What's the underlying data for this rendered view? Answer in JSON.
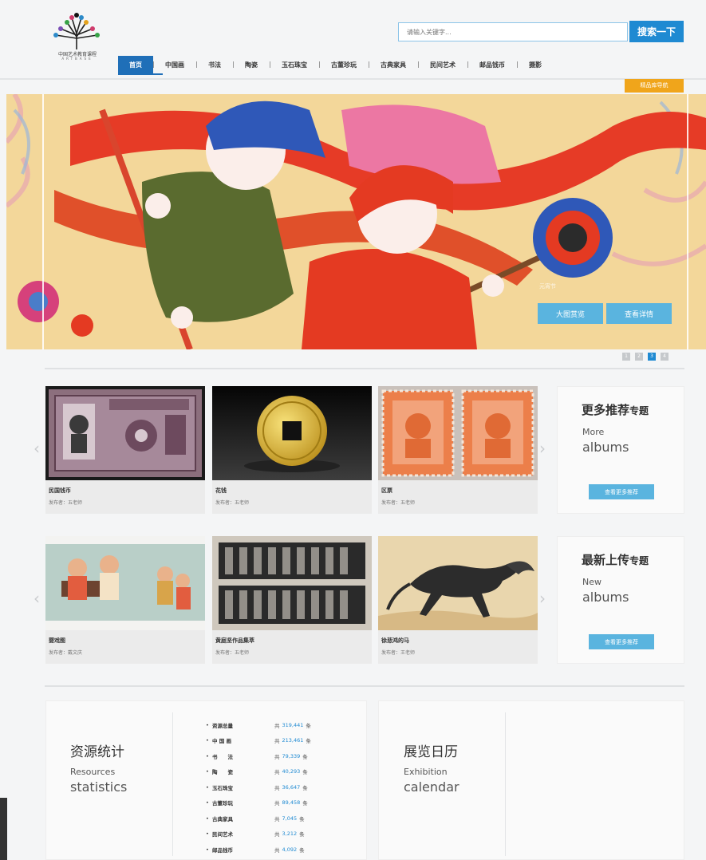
{
  "header": {
    "logo_caption": "中国艺术教育课程",
    "logo_sub": "ARTBASE",
    "search_placeholder": "请输入关键字...",
    "search_button": "搜索一下"
  },
  "nav": {
    "items": [
      "首页",
      "中国画",
      "书法",
      "陶瓷",
      "玉石珠宝",
      "古董珍玩",
      "古典家具",
      "民间艺术",
      "邮品钱币",
      "摄影"
    ],
    "active_index": 0
  },
  "guide_tag": "精品库导航",
  "banner": {
    "caption": "元宵节",
    "button_large": "大图赏览",
    "button_detail": "查看详情",
    "dots": [
      "1",
      "2",
      "3",
      "4"
    ],
    "active_dot": 2
  },
  "row1": {
    "cards": [
      {
        "title": "民国钱币",
        "author": "发布者：五老师"
      },
      {
        "title": "花钱",
        "author": "发布者：五老师"
      },
      {
        "title": "区票",
        "author": "发布者：五老师"
      }
    ],
    "side": {
      "title": "更多推荐",
      "title_suffix": "专题",
      "en1": "More",
      "en2": "albums",
      "button": "查看更多推荐"
    }
  },
  "row2": {
    "cards": [
      {
        "title": "婴戏图",
        "author": "发布者：戴文庆"
      },
      {
        "title": "黄庭坚作品集萃",
        "author": "发布者：五老师"
      },
      {
        "title": "徐悲鸿的马",
        "author": "发布者：王老师"
      }
    ],
    "side": {
      "title": "最新上传",
      "title_suffix": "专题",
      "en1": "New",
      "en2": "albums",
      "button": "查看更多推荐"
    }
  },
  "resources": {
    "title": "资源统计",
    "en1": "Resources",
    "en2": "statistics",
    "rows": [
      {
        "label": "资源总量",
        "prefix": "共",
        "count": "319,441",
        "suffix": "条"
      },
      {
        "label": "中 国 画",
        "prefix": "共",
        "count": "213,461",
        "suffix": "条"
      },
      {
        "label": "书　　法",
        "prefix": "共",
        "count": "79,339",
        "suffix": "条"
      },
      {
        "label": "陶　　瓷",
        "prefix": "共",
        "count": "40,293",
        "suffix": "条"
      },
      {
        "label": "玉石珠宝",
        "prefix": "共",
        "count": "36,647",
        "suffix": "条"
      },
      {
        "label": "古董珍玩",
        "prefix": "共",
        "count": "89,458",
        "suffix": "条"
      },
      {
        "label": "古典家具",
        "prefix": "共",
        "count": "7,045",
        "suffix": "条"
      },
      {
        "label": "民间艺术",
        "prefix": "共",
        "count": "3,212",
        "suffix": "条"
      },
      {
        "label": "邮品钱币",
        "prefix": "共",
        "count": "4,092",
        "suffix": "条"
      }
    ]
  },
  "exhibition": {
    "title": "展览日历",
    "en1": "Exhibition",
    "en2": "calendar"
  },
  "colors": {
    "primary_blue": "#1f8ad2",
    "nav_active": "#1f6fb8",
    "light_button": "#5ab4df",
    "guide_orange": "#f0a51b"
  }
}
